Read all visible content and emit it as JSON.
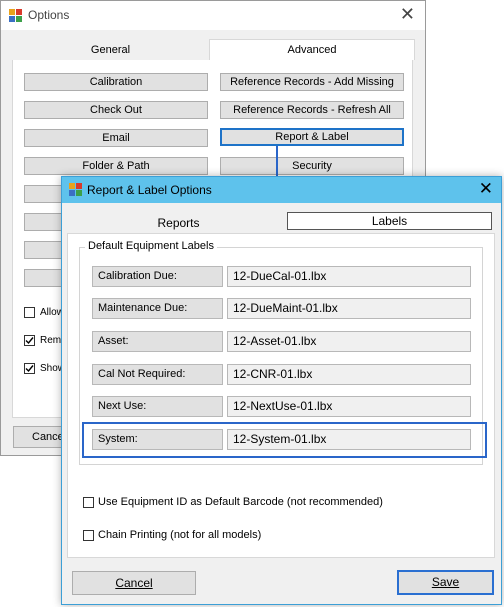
{
  "options_window": {
    "title": "Options",
    "tabs": [
      "General",
      "Advanced"
    ],
    "buttons_left": [
      "Calibration",
      "Check Out",
      "Email",
      "Folder & Path"
    ],
    "buttons_right": [
      "Reference Records - Add Missing",
      "Reference Records - Refresh All",
      "Report & Label",
      "Security"
    ],
    "checkbox_labels": [
      "Allow",
      "Reme",
      "Show"
    ],
    "checkbox_states": [
      false,
      true,
      true
    ],
    "cancel_label": "Cancel"
  },
  "report_label_window": {
    "title": "Report & Label Options",
    "tabs": {
      "reports": "Reports",
      "labels": "Labels"
    },
    "group_title": "Default Equipment Labels",
    "rows": [
      {
        "label": "Calibration Due:",
        "value": "12-DueCal-01.lbx"
      },
      {
        "label": "Maintenance Due:",
        "value": "12-DueMaint-01.lbx"
      },
      {
        "label": "Asset:",
        "value": "12-Asset-01.lbx"
      },
      {
        "label": "Cal Not Required:",
        "value": "12-CNR-01.lbx"
      },
      {
        "label": "Next Use:",
        "value": "12-NextUse-01.lbx"
      },
      {
        "label": "System:",
        "value": "12-System-01.lbx"
      }
    ],
    "checkboxes": [
      {
        "label": "Use Equipment ID as Default Barcode (not recommended)",
        "checked": false
      },
      {
        "label": "Chain Printing (not for all models)",
        "checked": false
      }
    ],
    "cancel_label": "Cancel",
    "save_label": "Save"
  },
  "colors": {
    "accent_blue": "#2a66c9",
    "title_bar_blue": "#5ec2ec"
  }
}
